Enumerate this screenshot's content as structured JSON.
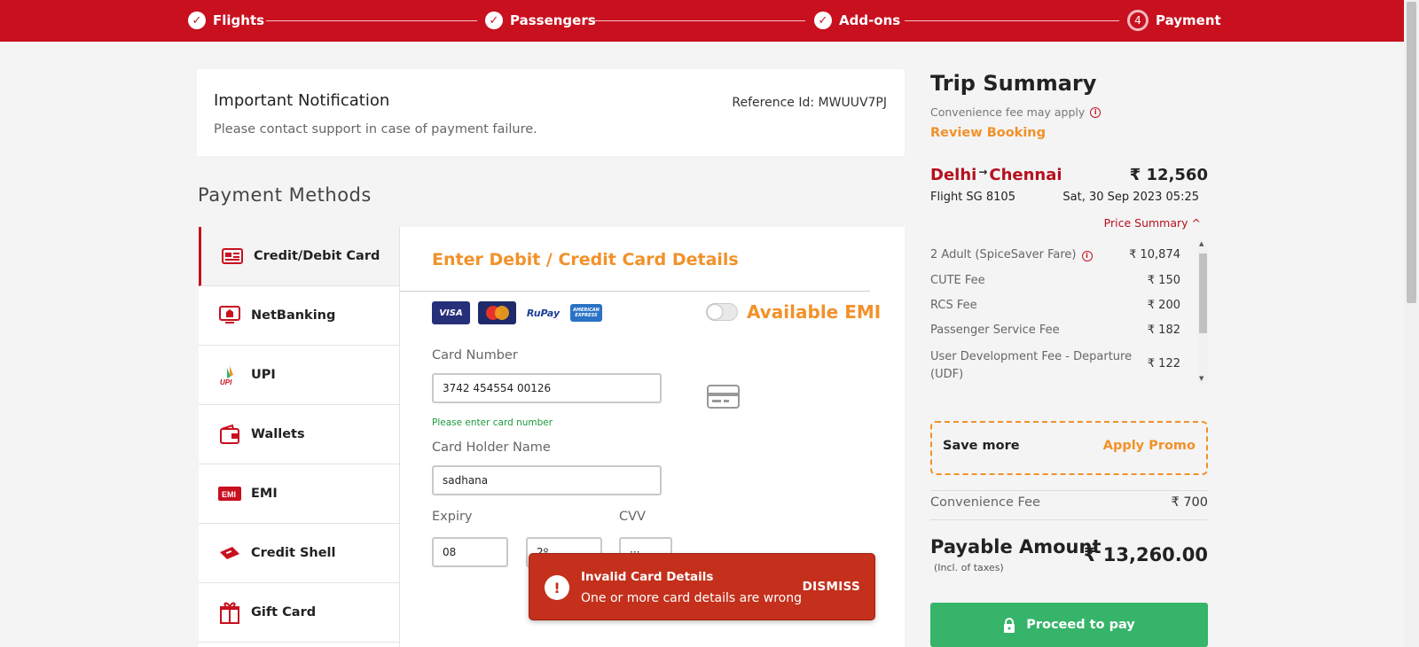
{
  "steps": [
    {
      "label": "Flights",
      "state": "done"
    },
    {
      "label": "Passengers",
      "state": "done"
    },
    {
      "label": "Add-ons",
      "state": "done"
    },
    {
      "label": "Payment",
      "number": "4",
      "state": "current"
    }
  ],
  "notification": {
    "title": "Important Notification",
    "reference": "Reference Id: MWUUV7PJ",
    "message": "Please contact support in case of payment failure."
  },
  "payment_methods": {
    "title": "Payment Methods",
    "items": [
      {
        "label": "Credit/Debit Card",
        "icon": "credit-card-icon",
        "active": true
      },
      {
        "label": "NetBanking",
        "icon": "bank-icon"
      },
      {
        "label": "UPI",
        "icon": "upi-icon"
      },
      {
        "label": "Wallets",
        "icon": "wallet-icon"
      },
      {
        "label": "EMI",
        "icon": "emi-icon"
      },
      {
        "label": "Credit Shell",
        "icon": "credit-shell-icon"
      },
      {
        "label": "Gift Card",
        "icon": "gift-icon"
      }
    ]
  },
  "card_form": {
    "title": "Enter Debit / Credit Card Details",
    "logos": [
      "VISA",
      "MasterCard",
      "RuPay",
      "AMERICAN EXPRESS"
    ],
    "emi_label": "Available EMI",
    "emi_enabled": false,
    "card_number_label": "Card Number",
    "card_number_value": "3742 454554 00126",
    "card_number_hint": "Please enter card number",
    "holder_label": "Card Holder Name",
    "holder_value": "sadhana",
    "expiry_label": "Expiry",
    "expiry_month": "08",
    "expiry_year": "2º",
    "cvv_label": "CVV",
    "cvv_value": "···"
  },
  "toast": {
    "title": "Invalid Card Details",
    "message": "One or more card details are wrong",
    "action": "DISMISS"
  },
  "summary": {
    "title": "Trip Summary",
    "convenience_note": "Convenience fee may apply",
    "review_link": "Review Booking",
    "origin": "Delhi",
    "destination": "Chennai",
    "price": "₹ 12,560",
    "flight": "Flight  SG 8105",
    "date": "Sat, 30 Sep 2023  05:25",
    "price_summary_label": "Price Summary ^",
    "fees": [
      {
        "label": "2 Adult  (SpiceSaver Fare)",
        "value": "₹ 10,874",
        "info": true
      },
      {
        "label": "CUTE Fee",
        "value": "₹ 150"
      },
      {
        "label": "RCS Fee",
        "value": "₹ 200"
      },
      {
        "label": "Passenger Service Fee",
        "value": "₹ 182"
      },
      {
        "label": "User Development Fee - Departure (UDF)",
        "value": "₹ 122"
      }
    ],
    "promo_left": "Save more",
    "promo_right": "Apply Promo",
    "convenience_fee_label": "Convenience Fee",
    "convenience_fee_value": "₹ 700",
    "payable_label": "Payable Amount",
    "payable_sub": "(Incl. of taxes)",
    "payable_value": "₹ 13,260.00",
    "proceed_label": "Proceed to pay"
  },
  "colors": {
    "brand_red": "#c8101f",
    "accent_orange": "#f2912a",
    "success_green": "#36b46a",
    "error_red": "#c4301c"
  }
}
